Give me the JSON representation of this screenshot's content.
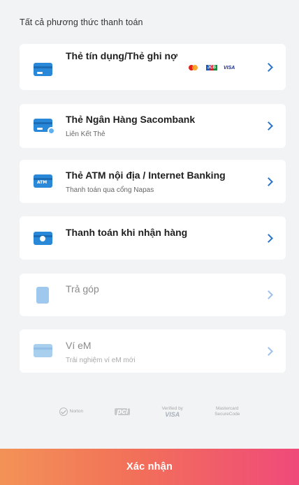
{
  "section_title": "Tất cả phương thức thanh toán",
  "methods": [
    {
      "title": "Thẻ tín dụng/Thẻ ghi nợ",
      "subtitle": "",
      "icon": "credit-card-icon",
      "enabled": true
    },
    {
      "title": "Thẻ Ngân Hàng Sacombank",
      "subtitle": "Liên Kết Thẻ",
      "icon": "bank-card-user-icon",
      "enabled": true
    },
    {
      "title": "Thẻ ATM nội địa / Internet Banking",
      "subtitle": "Thanh toán qua cổng Napas",
      "icon": "atm-card-icon",
      "enabled": true
    },
    {
      "title": "Thanh toán khi nhận hàng",
      "subtitle": "",
      "icon": "cash-icon",
      "enabled": true
    },
    {
      "title": "Trả góp",
      "subtitle": "",
      "icon": "installment-icon",
      "enabled": false
    },
    {
      "title": "Ví eM",
      "subtitle": "Trải nghiệm ví eM mới",
      "icon": "wallet-icon",
      "enabled": false
    }
  ],
  "card_brands": {
    "mastercard": "mastercard-icon",
    "jcb": "JCB",
    "visa": "VISA"
  },
  "security_logos": {
    "norton": "Norton",
    "pci": "pci",
    "visa_verified_line1": "Verified by",
    "visa_verified_line2": "VISA",
    "mastercard_line1": "Mastercard",
    "mastercard_line2": "SecureCode"
  },
  "confirm_label": "Xác nhận",
  "colors": {
    "accent": "#2a74c9",
    "button_start": "#f39257",
    "button_end": "#ef4a7a",
    "background": "#f2f3f5"
  }
}
